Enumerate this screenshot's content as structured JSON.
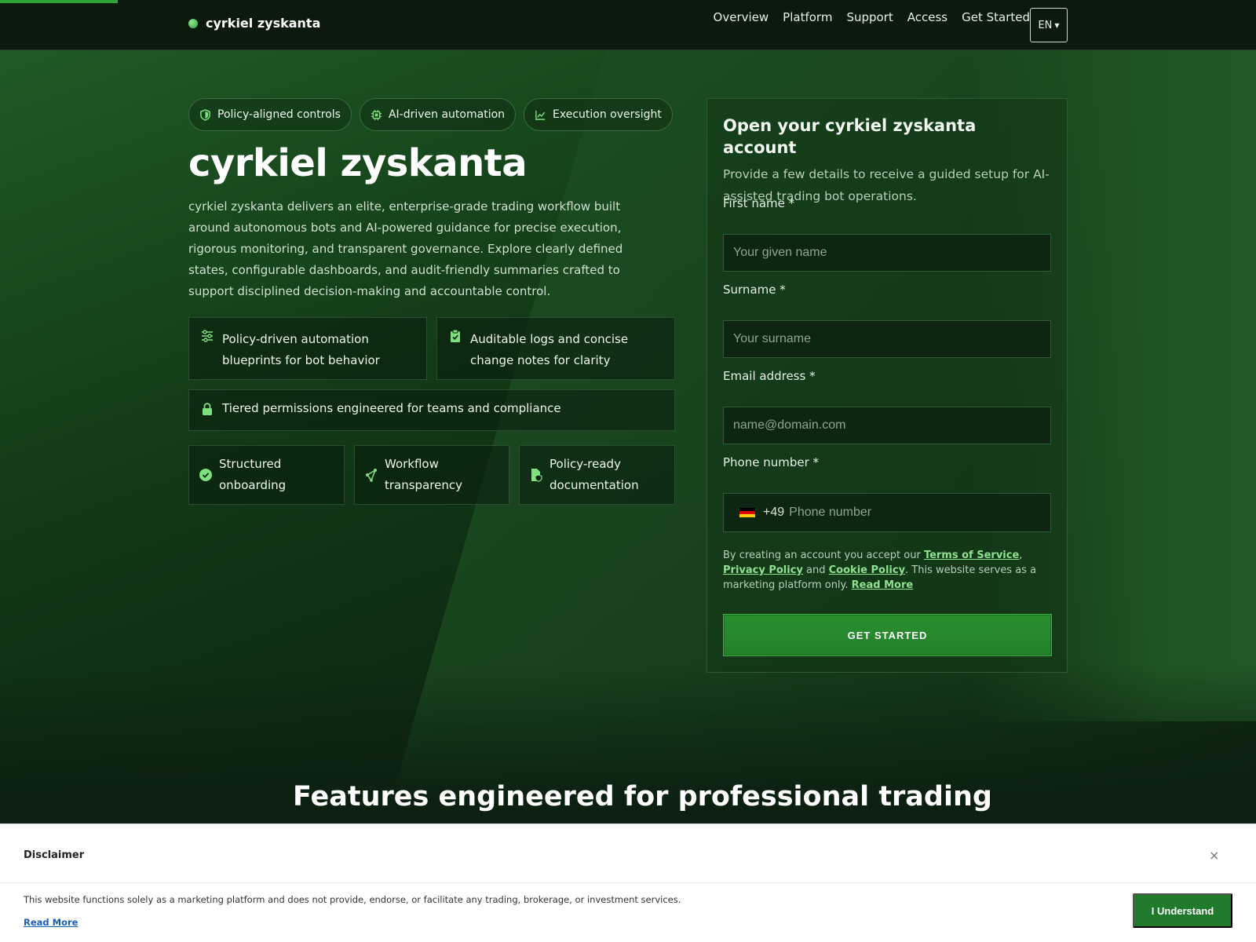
{
  "header": {
    "brand": "cyrkiel zyskanta",
    "nav": [
      "Overview",
      "Platform",
      "Support",
      "Access",
      "Get Started"
    ],
    "lang": "EN"
  },
  "hero": {
    "badges": [
      "Policy-aligned controls",
      "AI-driven automation",
      "Execution oversight"
    ],
    "title": "cyrkiel zyskanta",
    "description": "cyrkiel zyskanta delivers an elite, enterprise-grade trading workflow built around autonomous bots and AI-powered guidance for precise execution, rigorous monitoring, and transparent governance. Explore clearly defined states, configurable dashboards, and audit-friendly summaries crafted to support disciplined decision-making and accountable control.",
    "features": [
      "Policy-driven automation blueprints for bot behavior",
      "Auditable logs and concise change notes for clarity",
      "Tiered permissions engineered for teams and compliance"
    ],
    "highlights": [
      "Structured onboarding",
      "Workflow transparency",
      "Policy-ready documentation"
    ]
  },
  "form": {
    "title": "Open your cyrkiel zyskanta account",
    "subtitle": "Provide a few details to receive a guided setup for AI-assisted trading bot operations.",
    "first_name_label": "First name *",
    "first_name_placeholder": "Your given name",
    "surname_label": "Surname *",
    "surname_placeholder": "Your surname",
    "email_label": "Email address *",
    "email_placeholder": "name@domain.com",
    "phone_label": "Phone number *",
    "phone_code": "+49",
    "phone_placeholder": "Phone number",
    "terms_prefix": "By creating an account you accept our ",
    "terms_link": "Terms of Service",
    "comma": ", ",
    "privacy_link": "Privacy Policy",
    "and": " and ",
    "cookie_link": "Cookie Policy",
    "terms_suffix": ". This website serves as a marketing platform only. ",
    "read_more": "Read More",
    "submit": "GET STARTED"
  },
  "section": {
    "title": "Features engineered for professional trading"
  },
  "disclaimer": {
    "title": "Disclaimer",
    "text": "This website functions solely as a marketing platform and does not provide, endorse, or facilitate any trading, brokerage, or investment services.",
    "read_more": "Read More",
    "button": "I Understand",
    "close": "×"
  },
  "colors": {
    "accent": "#2fa33a",
    "link": "#8fe28f",
    "button": "#1f7a2c"
  },
  "icons": {
    "badge_1": "shield-icon",
    "badge_2": "chip-icon",
    "badge_3": "line-chart-icon",
    "feature_1": "sliders-icon",
    "feature_2": "clipboard-check-icon",
    "feature_3": "lock-icon",
    "highlight_1": "check-circle-icon",
    "highlight_2": "share-nodes-icon",
    "highlight_3": "file-shield-icon",
    "phone_flag": "germany-flag-icon"
  }
}
